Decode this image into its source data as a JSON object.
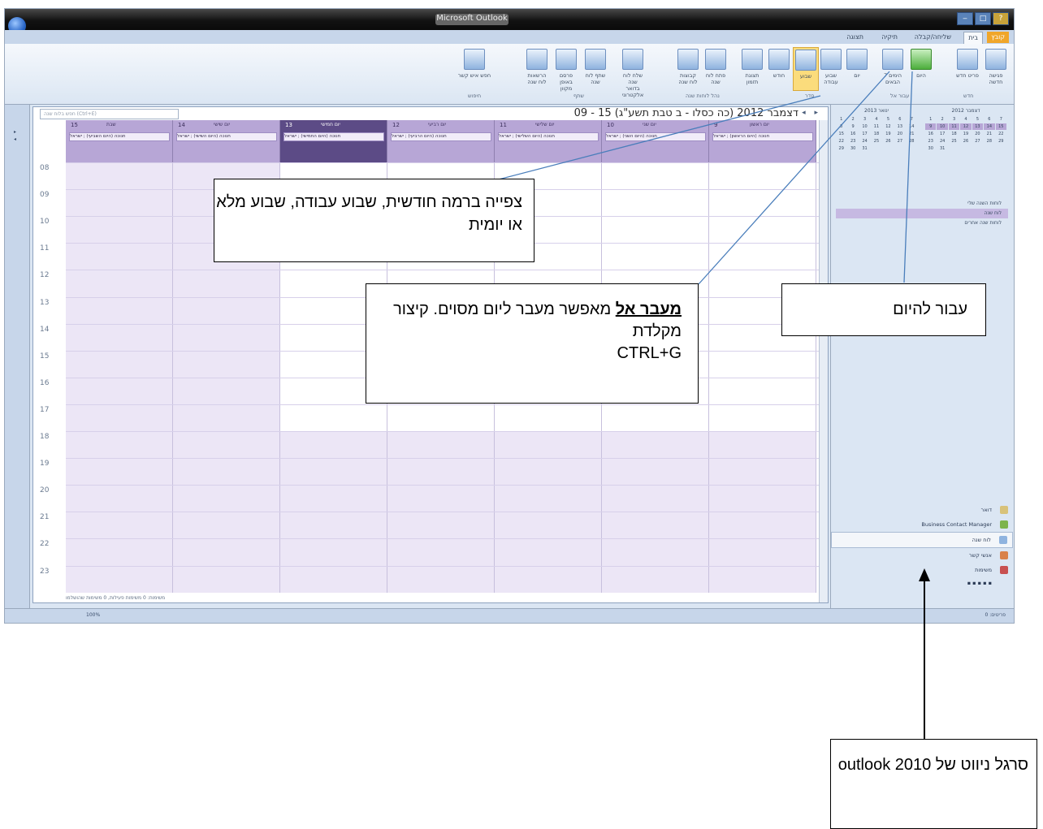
{
  "window": {
    "title": "Microsoft Outlook"
  },
  "ribbon": {
    "tabs": [
      "קובץ",
      "בית",
      "שליחה/קבלה",
      "תיקיה",
      "תצוגה"
    ],
    "buttons": [
      "פגישה חדשה",
      "פריט חדש",
      "היום",
      "7 הימים הבאים",
      "יום",
      "שבוע עבודה",
      "שבוע",
      "חודש",
      "תצוגת תזמון",
      "פתח לוח שנה",
      "קבוצות לוח שנה",
      "שלח לוח שנה בדואר אלקטרוני",
      "שתף לוח שנה",
      "פרסם באופן מקוון",
      "הרשאות לוח שנה",
      "חפש איש קשר"
    ],
    "groups": [
      "חדש",
      "עבור אל",
      "סדר",
      "נהל לוחות שנה",
      "שתף",
      "חיפוש"
    ]
  },
  "calendar": {
    "search_placeholder": "חפש בלוח שנה (Ctrl+E)",
    "range_title": "09 - 15 דצמבר 2012 (כה כסלו - ב טבת תשע\"ג)",
    "days": [
      {
        "num": "15",
        "name": "שבת",
        "event": "חנוכה (היום השביעי) ; ישראל",
        "selected": false
      },
      {
        "num": "14",
        "name": "יום שישי",
        "event": "חנוכה (היום השישי) ; ישראל",
        "selected": false
      },
      {
        "num": "13",
        "name": "יום חמישי",
        "event": "חנוכה (היום החמישי) ; ישראל",
        "selected": true
      },
      {
        "num": "12",
        "name": "יום רביעי",
        "event": "חנוכה (היום הרביעי) ; ישראל",
        "selected": false
      },
      {
        "num": "11",
        "name": "יום שלישי",
        "event": "חנוכה (היום השלישי) ; ישראל",
        "selected": false
      },
      {
        "num": "10",
        "name": "יום שני",
        "event": "חנוכה (היום השני) ; ישראל",
        "selected": false
      },
      {
        "num": "9",
        "name": "יום ראשון",
        "event": "חנוכה (היום הראשון) ; ישראל",
        "selected": false
      }
    ],
    "times": [
      "08",
      "09",
      "10",
      "11",
      "12",
      "13",
      "14",
      "15",
      "16",
      "17",
      "18",
      "19",
      "20",
      "21",
      "22",
      "23"
    ],
    "status_line": "משימות: 0 משימות פעילות, 0 משימות שהושלמו"
  },
  "right_pane": {
    "month1": "דצמבר 2012",
    "month2": "ינואר 2013",
    "my_calendars_header": "לוחות השנה שלי",
    "my_calendars": [
      "לוח שנה",
      "לוחות שנה אחרים"
    ],
    "nav_items": [
      "דואר",
      "Business Contact Manager",
      "לוח שנה",
      "אנשי קשר",
      "משימות"
    ]
  },
  "statusbar": {
    "left": "פריטים: 0",
    "zoom": "100%"
  },
  "callouts": {
    "view": "צפייה ברמה חודשית, שבוע עבודה, שבוע מלא או יומית",
    "goto_bold": "מעבר אל",
    "goto_rest": " מאפשר מעבר ליום מסוים. קיצור מקלדת",
    "goto_shortcut": "CTRL+G",
    "today": "עבור להיום",
    "navbar": "סרגל ניווט של outlook 2010"
  }
}
